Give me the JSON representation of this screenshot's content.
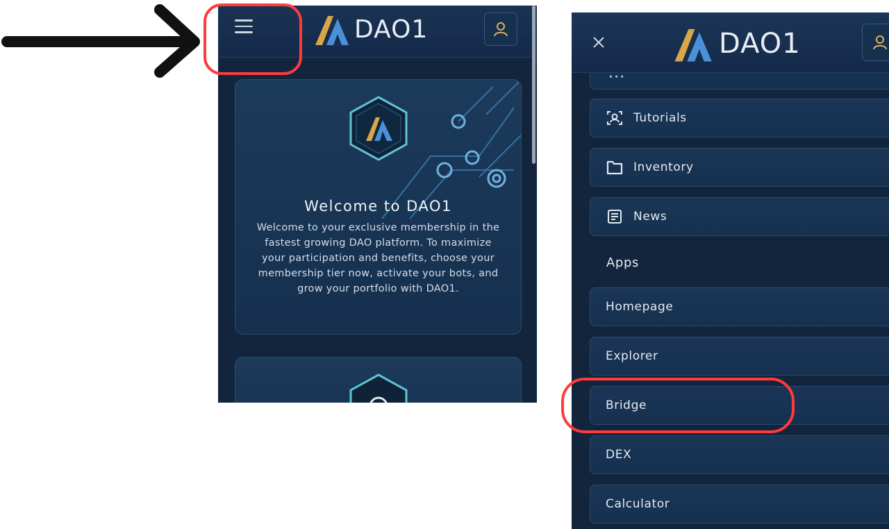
{
  "left_screen": {
    "header": {
      "logo_text": "DAO1"
    },
    "welcome_card": {
      "title": "Welcome to DAO1",
      "body": "Welcome to your exclusive membership in the fastest growing DAO platform. To maximize your participation and benefits, choose your membership tier now, activate your bots, and grow your portfolio with DAO1."
    }
  },
  "right_screen": {
    "header": {
      "logo_text": "DAO1"
    },
    "menu_items": [
      {
        "label": "Tutorials",
        "icon": "tutorials-icon"
      },
      {
        "label": "Inventory",
        "icon": "folder-icon"
      },
      {
        "label": "News",
        "icon": "news-icon"
      }
    ],
    "apps_label": "Apps",
    "apps": [
      "Homepage",
      "Explorer",
      "Bridge",
      "DEX",
      "Calculator"
    ]
  },
  "colors": {
    "background": "#13253d",
    "highlight": "#ff3b3b",
    "logo_gold": "#d9a64a",
    "logo_blue": "#4a90d9"
  }
}
